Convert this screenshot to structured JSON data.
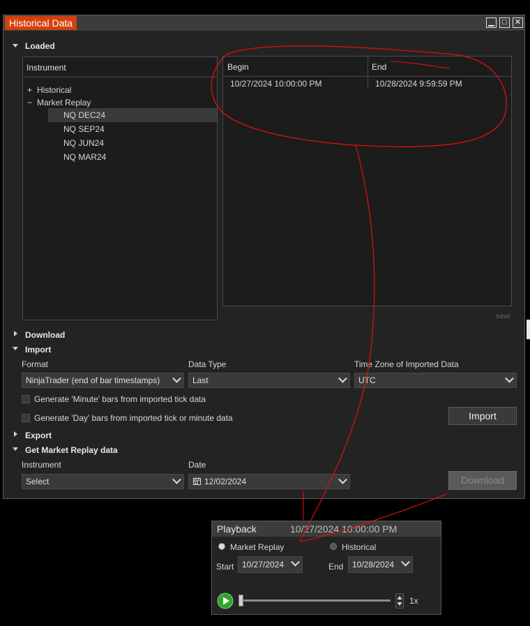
{
  "window": {
    "title": "Historical Data",
    "controls": {
      "minimize": "▁",
      "maximize": "□",
      "close": "✕"
    }
  },
  "loaded": {
    "label": "Loaded",
    "instrument_header": "Instrument",
    "tree": {
      "historical": {
        "sign": "+",
        "label": "Historical"
      },
      "market_replay": {
        "sign": "−",
        "label": "Market Replay"
      },
      "children": [
        "NQ DEC24",
        "NQ SEP24",
        "NQ JUN24",
        "NQ MAR24"
      ]
    },
    "table": {
      "begin_header": "Begin",
      "end_header": "End",
      "rows": [
        {
          "begin": "10/27/2024 10:00:00 PM",
          "end": "10/28/2024 9:59:59 PM"
        }
      ]
    },
    "save_link": "save"
  },
  "download": {
    "label": "Download"
  },
  "import": {
    "label": "Import",
    "format_label": "Format",
    "format_value": "NinjaTrader (end of bar timestamps)",
    "data_type_label": "Data Type",
    "data_type_value": "Last",
    "tz_label": "Time Zone of Imported Data",
    "tz_value": "UTC",
    "cb_minute": "Generate 'Minute' bars from imported tick data",
    "cb_day": "Generate 'Day' bars from imported tick or minute data",
    "import_button": "Import"
  },
  "export": {
    "label": "Export"
  },
  "replay_data": {
    "label": "Get Market Replay data",
    "instrument_label": "Instrument",
    "instrument_value": "Select",
    "date_label": "Date",
    "date_value": "12/02/2024",
    "download_button": "Download"
  },
  "playback": {
    "title": "Playback",
    "time": "10/27/2024 10:00:00 PM",
    "radio_market_replay": "Market Replay",
    "radio_historical": "Historical",
    "start_label": "Start",
    "start_value": "10/27/2024",
    "end_label": "End",
    "end_value": "10/28/2024",
    "speed": "1x"
  },
  "colors": {
    "title_accent": "#d4400f",
    "annotation": "#e01010",
    "play_green": "#2fa52f"
  }
}
